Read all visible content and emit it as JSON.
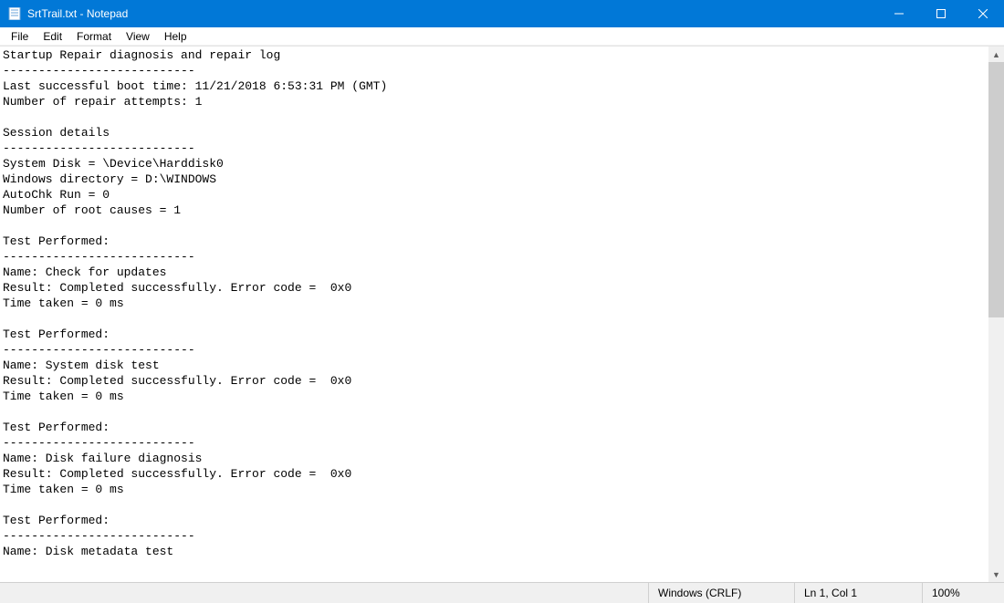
{
  "titlebar": {
    "title": "SrtTrail.txt - Notepad"
  },
  "menu": {
    "file": "File",
    "edit": "Edit",
    "format": "Format",
    "view": "View",
    "help": "Help"
  },
  "content": "Startup Repair diagnosis and repair log\n---------------------------\nLast successful boot time: 11/21/2018 6:53:31 PM (GMT)\nNumber of repair attempts: 1\n\nSession details\n---------------------------\nSystem Disk = \\Device\\Harddisk0\nWindows directory = D:\\WINDOWS\nAutoChk Run = 0\nNumber of root causes = 1\n\nTest Performed: \n---------------------------\nName: Check for updates\nResult: Completed successfully. Error code =  0x0\nTime taken = 0 ms\n\nTest Performed: \n---------------------------\nName: System disk test\nResult: Completed successfully. Error code =  0x0\nTime taken = 0 ms\n\nTest Performed: \n---------------------------\nName: Disk failure diagnosis\nResult: Completed successfully. Error code =  0x0\nTime taken = 0 ms\n\nTest Performed: \n---------------------------\nName: Disk metadata test",
  "statusbar": {
    "encoding": "Windows (CRLF)",
    "position": "Ln 1, Col 1",
    "zoom": "100%"
  }
}
